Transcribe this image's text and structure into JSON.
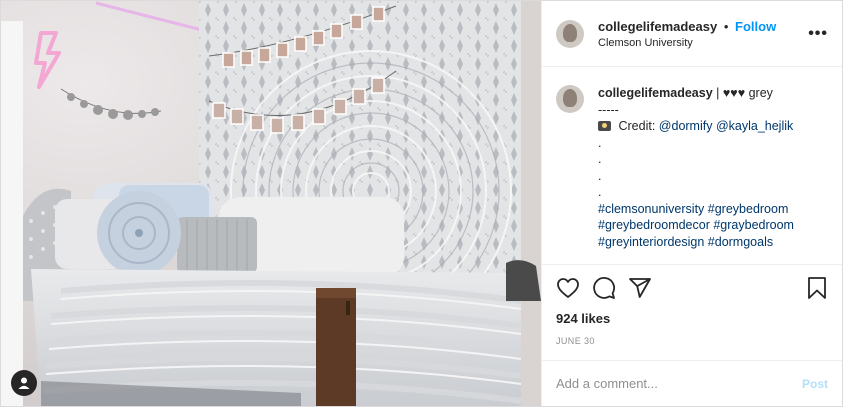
{
  "header": {
    "username": "collegelifemadeasy",
    "separator": "•",
    "follow_label": "Follow",
    "location": "Clemson University",
    "more_label": "•••"
  },
  "caption": {
    "username": "collegelifemadeasy",
    "title_text": "| ♥♥♥ grey",
    "divider": "-----",
    "credit_prefix": "Credit:",
    "credit_tag_1": "@dormify",
    "credit_tag_2": "@kayla_hejlik",
    "dots": [
      ".",
      ".",
      ".",
      "."
    ],
    "hashtags_line_1": "#clemsonuniversity #greybedroom",
    "hashtags_line_2": "#greybedroomdecor #graybedroom",
    "hashtags_line_3": "#greyinteriordesign #dormgoals"
  },
  "stats": {
    "likes": "924 likes",
    "date": "JUNE 30"
  },
  "comment": {
    "placeholder": "Add a comment...",
    "post_label": "Post"
  },
  "icons": {
    "like": "heart-icon",
    "comment": "comment-icon",
    "share": "share-icon",
    "save": "bookmark-icon",
    "tagged": "user-tag-icon",
    "credit": "camera-icon"
  },
  "colors": {
    "follow": "#0095f6",
    "link": "#00376b",
    "post_disabled": "#b2dffc",
    "muted": "#8e8e8e"
  }
}
